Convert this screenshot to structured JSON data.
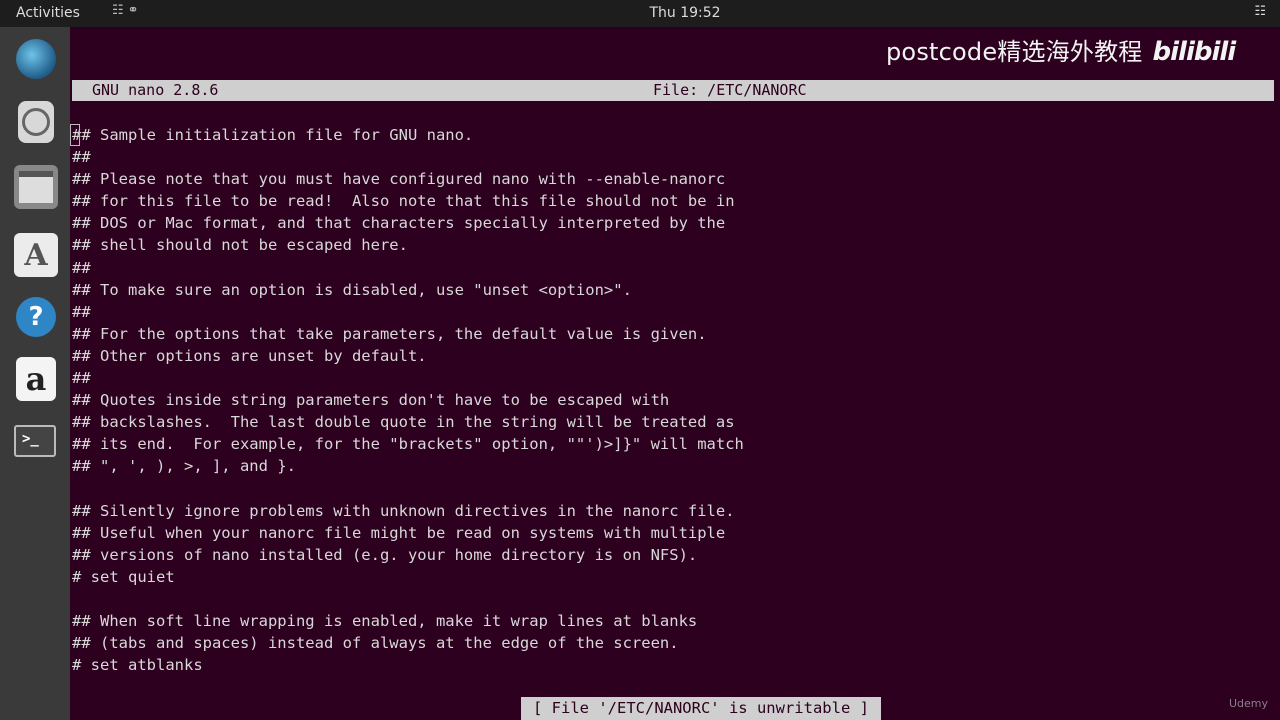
{
  "topbar": {
    "activities": "Activities",
    "clock": "Thu 19:52",
    "tray_icon": "network-icon"
  },
  "dock": {
    "items": [
      "browser-icon",
      "mail-icon",
      "files-icon",
      "font-viewer-icon",
      "help-icon",
      "amazon-icon",
      "terminal-icon"
    ],
    "font_glyph": "A",
    "help_glyph": "?",
    "amazon_glyph": "a",
    "terminal_glyph": ">_"
  },
  "window": {
    "watermark_text": "postcode精选海外教程",
    "watermark_logo": "bilibili"
  },
  "nano": {
    "version": "GNU nano 2.8.6",
    "file": "File: /ETC/NANORC",
    "lines": [
      "## Sample initialization file for GNU nano.",
      "##",
      "## Please note that you must have configured nano with --enable-nanorc",
      "## for this file to be read!  Also note that this file should not be in",
      "## DOS or Mac format, and that characters specially interpreted by the",
      "## shell should not be escaped here.",
      "##",
      "## To make sure an option is disabled, use \"unset <option>\".",
      "##",
      "## For the options that take parameters, the default value is given.",
      "## Other options are unset by default.",
      "##",
      "## Quotes inside string parameters don't have to be escaped with",
      "## backslashes.  The last double quote in the string will be treated as",
      "## its end.  For example, for the \"brackets\" option, \"\"')>]}\" will match",
      "## \", ', ), >, ], and }.",
      "",
      "## Silently ignore problems with unknown directives in the nanorc file.",
      "## Useful when your nanorc file might be read on systems with multiple",
      "## versions of nano installed (e.g. your home directory is on NFS).",
      "# set quiet",
      "",
      "## When soft line wrapping is enabled, make it wrap lines at blanks",
      "## (tabs and spaces) instead of always at the edge of the screen.",
      "# set atblanks"
    ],
    "status": "[ File '/ETC/NANORC' is unwritable ]"
  },
  "colors": {
    "terminal_bg": "#2c001e",
    "text": "#d8d8d8",
    "bar_bg": "#cfcfcf"
  },
  "udemy": "Udemy"
}
